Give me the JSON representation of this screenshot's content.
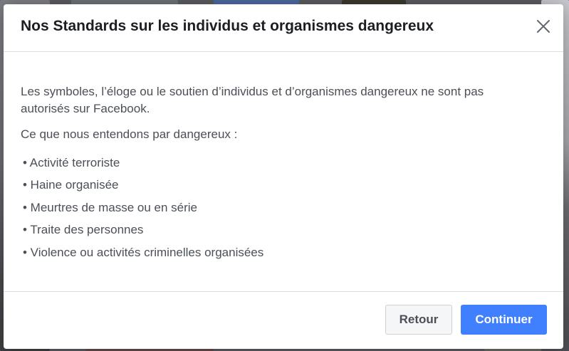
{
  "modal": {
    "title": "Nos Standards sur les individus et organismes dangereux",
    "close_icon": "close-icon",
    "intro": "Les symboles, l’éloge ou le soutien d’individus et d’organismes dangereux ne sont pas autorisés sur Facebook.",
    "lead": "Ce que nous entendons par dangereux :",
    "bullets": [
      "• Activité terroriste",
      "• Haine organisée",
      "• Meurtres de masse ou en série",
      "• Traite des personnes",
      "• Violence ou activités criminelles organisées"
    ],
    "back_label": "Retour",
    "continue_label": "Continuer"
  },
  "colors": {
    "primary_button": "#4080ff",
    "secondary_button": "#f5f6f7",
    "title_text": "#1c1e21",
    "body_text": "#4b4f56"
  }
}
